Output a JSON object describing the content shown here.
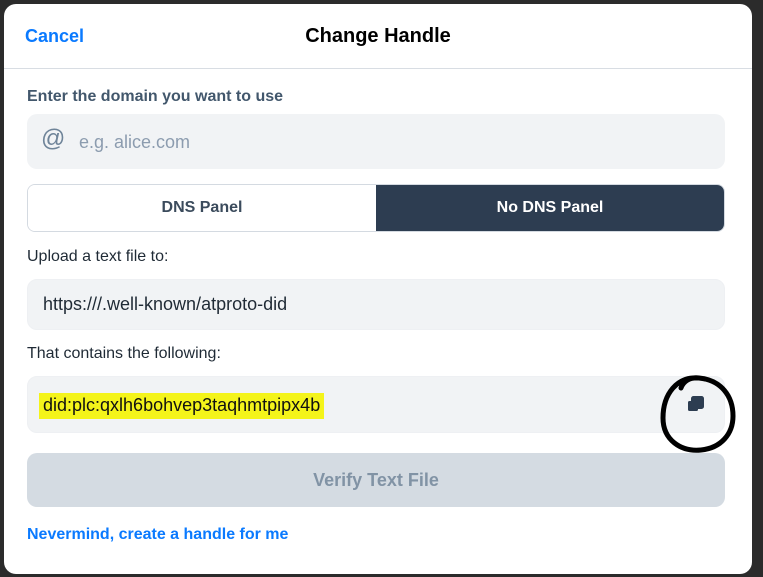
{
  "header": {
    "cancel_label": "Cancel",
    "title": "Change Handle"
  },
  "domain": {
    "label": "Enter the domain you want to use",
    "icon_glyph": "@",
    "icon": "at-icon",
    "placeholder": "e.g. alice.com",
    "value": ""
  },
  "tabs": [
    {
      "label": "DNS Panel",
      "selected": false
    },
    {
      "label": "No DNS Panel",
      "selected": true
    }
  ],
  "upload": {
    "label": "Upload a text file to:",
    "url": "https:///.well-known/atproto-did"
  },
  "contents": {
    "label": "That contains the following:",
    "did": "did:plc:qxlh6bohvep3taqhmtpipx4b",
    "copy_icon": "copy-icon",
    "highlight_color": "#f4f41a"
  },
  "verify": {
    "label": "Verify Text File",
    "disabled": true
  },
  "footer": {
    "nevermind_label": "Nevermind, create a handle for me"
  },
  "colors": {
    "accent": "#0a7aff",
    "active_tab": "#2d3d51",
    "disabled_button": "#d4dbe2"
  }
}
